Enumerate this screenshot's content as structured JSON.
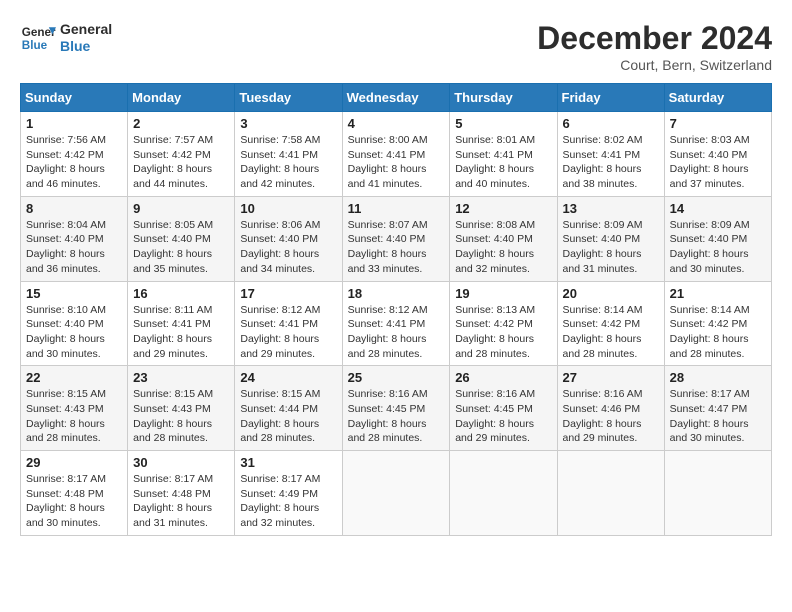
{
  "logo": {
    "line1": "General",
    "line2": "Blue"
  },
  "title": "December 2024",
  "subtitle": "Court, Bern, Switzerland",
  "weekdays": [
    "Sunday",
    "Monday",
    "Tuesday",
    "Wednesday",
    "Thursday",
    "Friday",
    "Saturday"
  ],
  "days": [
    {
      "num": "",
      "info": ""
    },
    {
      "num": "",
      "info": ""
    },
    {
      "num": "",
      "info": ""
    },
    {
      "num": "",
      "info": ""
    },
    {
      "num": "",
      "info": ""
    },
    {
      "num": "",
      "info": ""
    },
    {
      "num": "1",
      "info": "Sunrise: 7:56 AM\nSunset: 4:42 PM\nDaylight: 8 hours\nand 46 minutes."
    },
    {
      "num": "2",
      "info": "Sunrise: 7:57 AM\nSunset: 4:42 PM\nDaylight: 8 hours\nand 44 minutes."
    },
    {
      "num": "3",
      "info": "Sunrise: 7:58 AM\nSunset: 4:41 PM\nDaylight: 8 hours\nand 42 minutes."
    },
    {
      "num": "4",
      "info": "Sunrise: 8:00 AM\nSunset: 4:41 PM\nDaylight: 8 hours\nand 41 minutes."
    },
    {
      "num": "5",
      "info": "Sunrise: 8:01 AM\nSunset: 4:41 PM\nDaylight: 8 hours\nand 40 minutes."
    },
    {
      "num": "6",
      "info": "Sunrise: 8:02 AM\nSunset: 4:41 PM\nDaylight: 8 hours\nand 38 minutes."
    },
    {
      "num": "7",
      "info": "Sunrise: 8:03 AM\nSunset: 4:40 PM\nDaylight: 8 hours\nand 37 minutes."
    },
    {
      "num": "8",
      "info": "Sunrise: 8:04 AM\nSunset: 4:40 PM\nDaylight: 8 hours\nand 36 minutes."
    },
    {
      "num": "9",
      "info": "Sunrise: 8:05 AM\nSunset: 4:40 PM\nDaylight: 8 hours\nand 35 minutes."
    },
    {
      "num": "10",
      "info": "Sunrise: 8:06 AM\nSunset: 4:40 PM\nDaylight: 8 hours\nand 34 minutes."
    },
    {
      "num": "11",
      "info": "Sunrise: 8:07 AM\nSunset: 4:40 PM\nDaylight: 8 hours\nand 33 minutes."
    },
    {
      "num": "12",
      "info": "Sunrise: 8:08 AM\nSunset: 4:40 PM\nDaylight: 8 hours\nand 32 minutes."
    },
    {
      "num": "13",
      "info": "Sunrise: 8:09 AM\nSunset: 4:40 PM\nDaylight: 8 hours\nand 31 minutes."
    },
    {
      "num": "14",
      "info": "Sunrise: 8:09 AM\nSunset: 4:40 PM\nDaylight: 8 hours\nand 30 minutes."
    },
    {
      "num": "15",
      "info": "Sunrise: 8:10 AM\nSunset: 4:40 PM\nDaylight: 8 hours\nand 30 minutes."
    },
    {
      "num": "16",
      "info": "Sunrise: 8:11 AM\nSunset: 4:41 PM\nDaylight: 8 hours\nand 29 minutes."
    },
    {
      "num": "17",
      "info": "Sunrise: 8:12 AM\nSunset: 4:41 PM\nDaylight: 8 hours\nand 29 minutes."
    },
    {
      "num": "18",
      "info": "Sunrise: 8:12 AM\nSunset: 4:41 PM\nDaylight: 8 hours\nand 28 minutes."
    },
    {
      "num": "19",
      "info": "Sunrise: 8:13 AM\nSunset: 4:42 PM\nDaylight: 8 hours\nand 28 minutes."
    },
    {
      "num": "20",
      "info": "Sunrise: 8:14 AM\nSunset: 4:42 PM\nDaylight: 8 hours\nand 28 minutes."
    },
    {
      "num": "21",
      "info": "Sunrise: 8:14 AM\nSunset: 4:42 PM\nDaylight: 8 hours\nand 28 minutes."
    },
    {
      "num": "22",
      "info": "Sunrise: 8:15 AM\nSunset: 4:43 PM\nDaylight: 8 hours\nand 28 minutes."
    },
    {
      "num": "23",
      "info": "Sunrise: 8:15 AM\nSunset: 4:43 PM\nDaylight: 8 hours\nand 28 minutes."
    },
    {
      "num": "24",
      "info": "Sunrise: 8:15 AM\nSunset: 4:44 PM\nDaylight: 8 hours\nand 28 minutes."
    },
    {
      "num": "25",
      "info": "Sunrise: 8:16 AM\nSunset: 4:45 PM\nDaylight: 8 hours\nand 28 minutes."
    },
    {
      "num": "26",
      "info": "Sunrise: 8:16 AM\nSunset: 4:45 PM\nDaylight: 8 hours\nand 29 minutes."
    },
    {
      "num": "27",
      "info": "Sunrise: 8:16 AM\nSunset: 4:46 PM\nDaylight: 8 hours\nand 29 minutes."
    },
    {
      "num": "28",
      "info": "Sunrise: 8:17 AM\nSunset: 4:47 PM\nDaylight: 8 hours\nand 30 minutes."
    },
    {
      "num": "29",
      "info": "Sunrise: 8:17 AM\nSunset: 4:48 PM\nDaylight: 8 hours\nand 30 minutes."
    },
    {
      "num": "30",
      "info": "Sunrise: 8:17 AM\nSunset: 4:48 PM\nDaylight: 8 hours\nand 31 minutes."
    },
    {
      "num": "31",
      "info": "Sunrise: 8:17 AM\nSunset: 4:49 PM\nDaylight: 8 hours\nand 32 minutes."
    },
    {
      "num": "",
      "info": ""
    },
    {
      "num": "",
      "info": ""
    },
    {
      "num": "",
      "info": ""
    },
    {
      "num": "",
      "info": ""
    },
    {
      "num": "",
      "info": ""
    }
  ]
}
